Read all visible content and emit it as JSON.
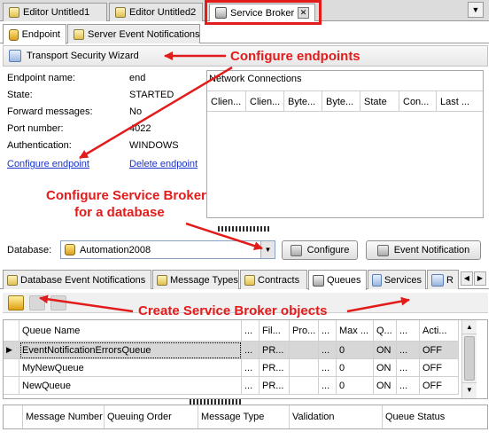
{
  "document_tabs": [
    {
      "label": "Editor Untitled1"
    },
    {
      "label": "Editor Untitled2"
    },
    {
      "label": "Service Broker",
      "active": true
    }
  ],
  "sub_tabs": [
    {
      "label": "Endpoint",
      "active": true
    },
    {
      "label": "Server Event Notifications"
    }
  ],
  "wizard": {
    "label": "Transport Security Wizard"
  },
  "endpoint": {
    "props": [
      {
        "label": "Endpoint name:",
        "value": "end"
      },
      {
        "label": "State:",
        "value": "STARTED"
      },
      {
        "label": "Forward messages:",
        "value": "No"
      },
      {
        "label": "Port number:",
        "value": "4022"
      },
      {
        "label": "Authentication:",
        "value": "WINDOWS"
      }
    ],
    "configure_link": "Configure endpoint",
    "delete_link": "Delete endpoint"
  },
  "network": {
    "title": "Network Connections",
    "columns": [
      "Clien...",
      "Clien...",
      "Byte...",
      "Byte...",
      "State",
      "Con...",
      "Last ..."
    ]
  },
  "database": {
    "label": "Database:",
    "value": "Automation2008",
    "configure_button": "Configure",
    "event_button": "Event Notification"
  },
  "bottom_tabs": [
    {
      "label": "Database Event Notifications"
    },
    {
      "label": "Message Types"
    },
    {
      "label": "Contracts"
    },
    {
      "label": "Queues",
      "active": true
    },
    {
      "label": "Services"
    },
    {
      "label": "R"
    }
  ],
  "queues": {
    "columns": [
      "Queue Name",
      "...",
      "Fil...",
      "Pro...",
      "...",
      "Max ...",
      "Q...",
      "...",
      "Acti..."
    ],
    "rows": [
      [
        "EventNotificationErrorsQueue",
        "...",
        "PR...",
        "",
        "...",
        "0",
        "ON",
        "...",
        "OFF"
      ],
      [
        "MyNewQueue",
        "...",
        "PR...",
        "",
        "...",
        "0",
        "ON",
        "...",
        "OFF"
      ],
      [
        "NewQueue",
        "...",
        "PR...",
        "",
        "...",
        "0",
        "ON",
        "...",
        "OFF"
      ]
    ]
  },
  "messages": {
    "columns": [
      "Message Number",
      "Queuing Order",
      "Message Type",
      "Validation",
      "Queue Status"
    ]
  },
  "annotations": {
    "endpoints": "Configure endpoints",
    "broker_line1": "Configure Service Broker",
    "broker_line2": "for a database",
    "objects": "Create Service Broker objects"
  },
  "colors": {
    "annotation": "#e21b1b",
    "link": "#1a32c9",
    "selected_row": "#d7d7d7"
  }
}
